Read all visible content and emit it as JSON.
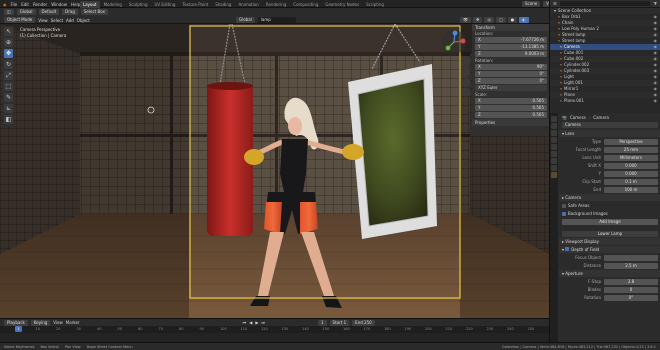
{
  "app": {
    "menu": [
      "File",
      "Edit",
      "Render",
      "Window",
      "Help"
    ],
    "workspace_tabs": [
      "Layout",
      "Modeling",
      "Sculpting",
      "UV Editing",
      "Texture Paint",
      "Shading",
      "Animation",
      "Rendering",
      "Compositing",
      "Geometry Nodes",
      "Scripting"
    ],
    "active_tab": "Layout",
    "scene_label": "Scene",
    "view_layer_label": "View Layer"
  },
  "viewport_header": {
    "editor_type": "Object Mode",
    "view_menu": "View",
    "select_menu": "Select",
    "add_menu": "Add",
    "object_menu": "Object",
    "orientation": "Global",
    "pivot_label": "Default",
    "drag_label": "Drag",
    "select_box": "Select Box",
    "snap_label": "Global",
    "search_value": "lamp",
    "options_label": "Options"
  },
  "viewport": {
    "info_line1": "Camera Perspective",
    "info_line2": "(1) Collection | Camera"
  },
  "n_panel": {
    "transform_title": "Transform",
    "location_label": "Location:",
    "location": [
      "-7.67726 m",
      "-13.1385 m",
      "9.0003 m"
    ],
    "rotation_label": "Rotation:",
    "rotation": [
      "90°",
      "0°",
      "0°"
    ],
    "mode_label": "XYZ Euler",
    "scale_label": "Scale:",
    "scale": [
      "0.565",
      "0.565",
      "0.565"
    ],
    "properties_title": "Properties",
    "axis": [
      "X",
      "Y",
      "Z"
    ]
  },
  "outliner": {
    "title": "Scene Collection",
    "search_placeholder": "",
    "items": [
      {
        "name": "Box Orb1",
        "selected": false
      },
      {
        "name": "Chain",
        "selected": false
      },
      {
        "name": "Low Poly Human 2",
        "selected": false
      },
      {
        "name": "Street lamp",
        "selected": false
      },
      {
        "name": "Street lamp",
        "selected": false
      },
      {
        "name": "Camera",
        "selected": true
      },
      {
        "name": "Cube.001",
        "selected": false
      },
      {
        "name": "Cube.002",
        "selected": false
      },
      {
        "name": "Cylinder.002",
        "selected": false
      },
      {
        "name": "Cylinder.003",
        "selected": false
      },
      {
        "name": "Light",
        "selected": false
      },
      {
        "name": "Light.001",
        "selected": false
      },
      {
        "name": "Mirror1",
        "selected": false
      },
      {
        "name": "Plane",
        "selected": false
      },
      {
        "name": "Plane.001",
        "selected": false
      }
    ]
  },
  "properties": {
    "object_name": "Camera",
    "data_name": "Camera",
    "lens_section": "Lens",
    "type_label": "Type",
    "type_value": "Perspective",
    "focal_length_label": "Focal Length",
    "focal_length_value": "25 mm",
    "lens_unit_label": "Lens Unit",
    "lens_unit_value": "Millimeters",
    "shift_x_label": "Shift X",
    "shift_x_value": "0.000",
    "shift_y_label": "Y",
    "shift_y_value": "0.000",
    "clip_start_label": "Clip Start",
    "clip_start_value": "0.1 m",
    "clip_end_label": "End",
    "clip_end_value": "100 m",
    "camera_section": "Camera",
    "safe_areas_label": "Safe Areas",
    "background_images_label": "Background Images",
    "add_image_label": "Add Image",
    "layer_label": "Lower Lamp",
    "viewport_display": "Viewport Display",
    "dof_label": "Depth of Field",
    "focus_object_label": "Focus Object",
    "focus_distance_label": "Distance",
    "focus_distance_value": "2.5 m",
    "aperture_label": "Aperture",
    "fstop_label": "F-Stop",
    "fstop_value": "2.8",
    "blades_label": "Blades",
    "blades_value": "0",
    "rotation_label": "Rotation",
    "rotation_value": "0°"
  },
  "timeline": {
    "playback_label": "Playback",
    "keying_label": "Keying",
    "view_label": "View",
    "marker_label": "Marker",
    "current_frame": "1",
    "start_label": "Start",
    "start_value": "1",
    "end_label": "End",
    "end_value": "250",
    "ticks": [
      "0",
      "10",
      "20",
      "30",
      "40",
      "50",
      "60",
      "70",
      "80",
      "90",
      "100",
      "110",
      "120",
      "130",
      "140",
      "150",
      "160",
      "170",
      "180",
      "190",
      "200",
      "210",
      "220",
      "230",
      "240",
      "250"
    ]
  },
  "status": {
    "select": "Select Keyframes",
    "box": "Box Select",
    "pan": "Pan View",
    "context": "Dope Sheet Context Menu",
    "version": "Collection | Camera | Verts:484,816 | Faces:483,212 | Tris:967,232 | Objects:1/13 | 3.6.1"
  },
  "colors": {
    "accent": "#4772b3",
    "camera_frame": "#e6c84a",
    "bag": "#c9302c",
    "glove": "#d4a627"
  }
}
